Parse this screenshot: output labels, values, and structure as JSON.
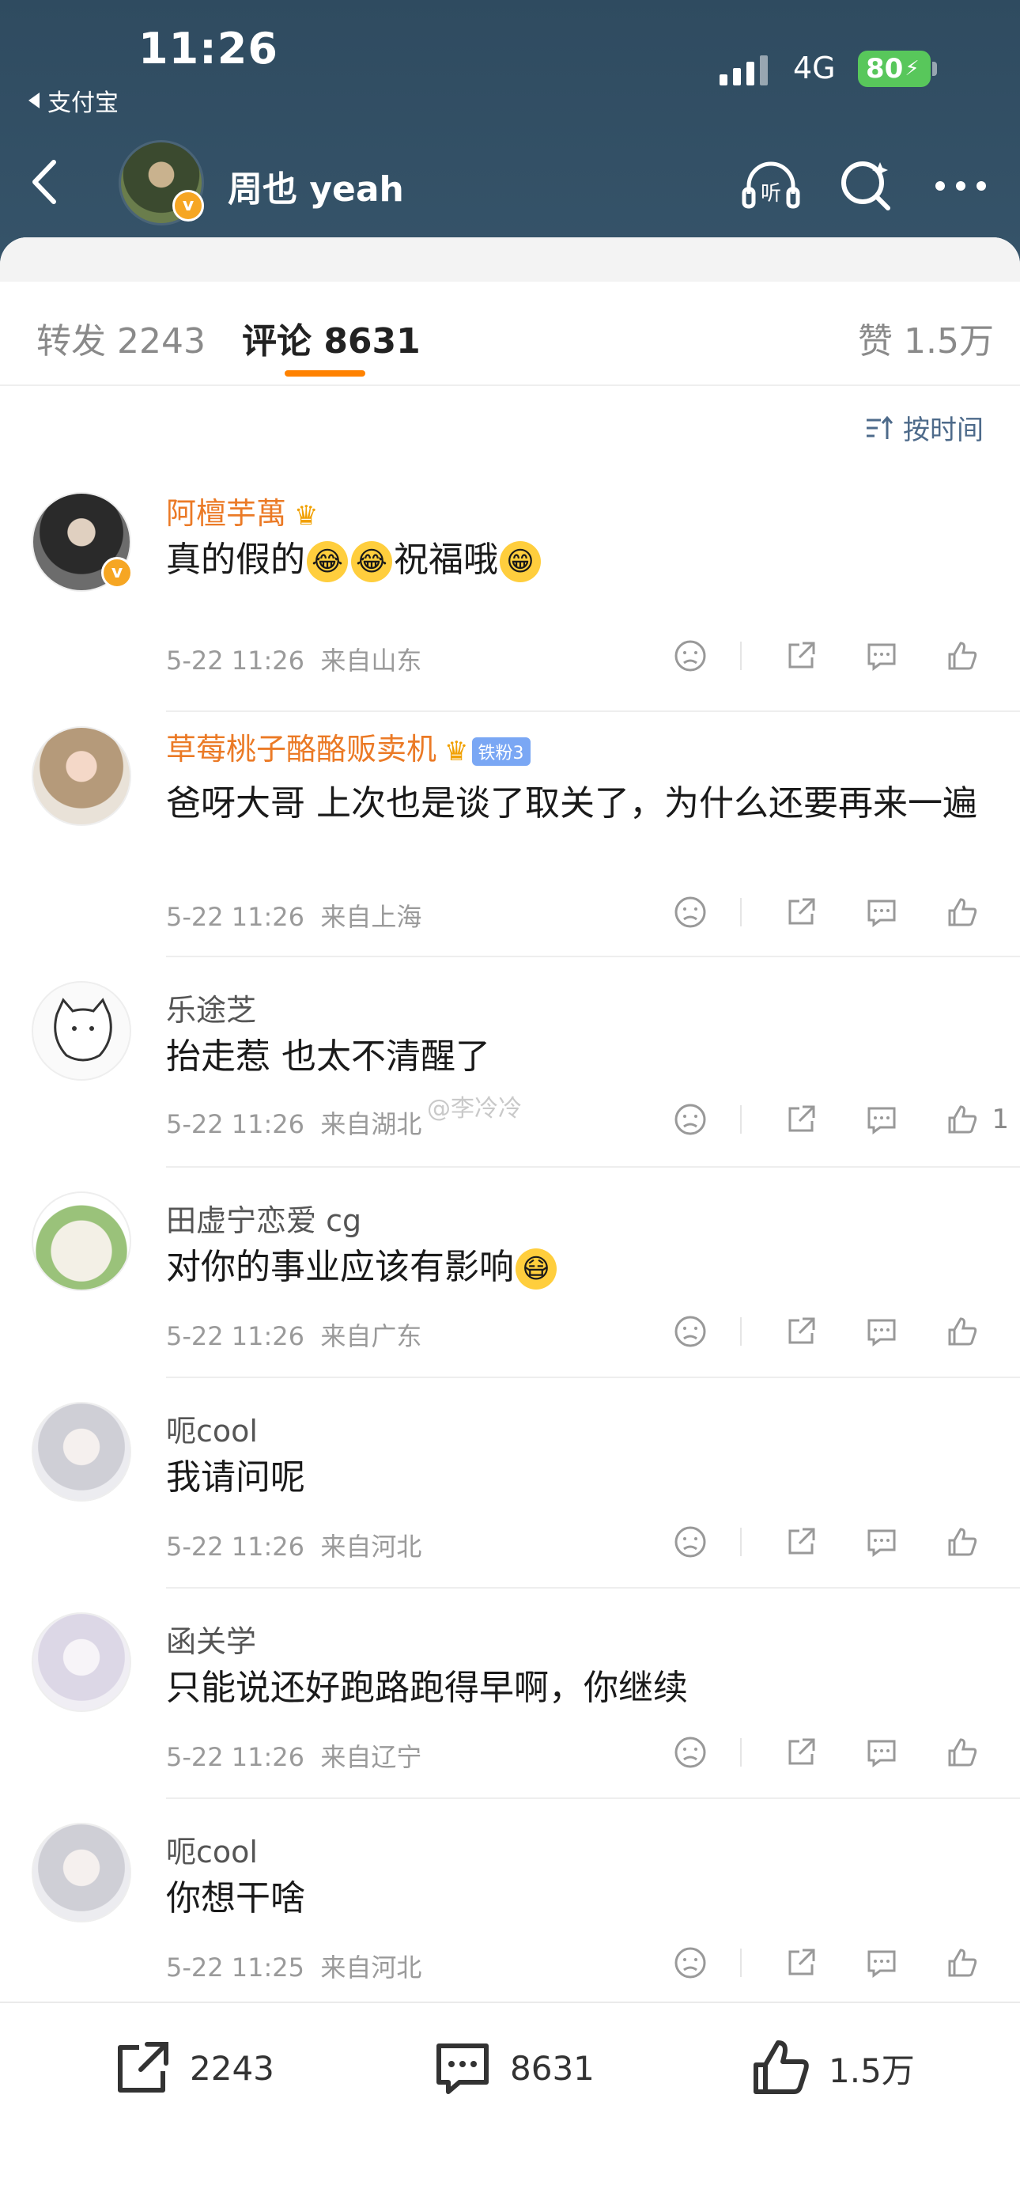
{
  "status_bar": {
    "time": "11:26",
    "back_app": "支付宝",
    "network": "4G",
    "battery": "80"
  },
  "header": {
    "user_name": "周也 yeah",
    "verified_badge": "v",
    "icons": [
      "back-icon",
      "listen-icon",
      "search-icon",
      "more-icon"
    ],
    "listen_label": "听"
  },
  "tabs": [
    {
      "label": "转发 2243"
    },
    {
      "label": "评论 8631"
    },
    {
      "label": "赞 1.5万"
    }
  ],
  "sort": {
    "label": "按时间"
  },
  "comments": [
    {
      "name": "阿檀芋萬",
      "text_parts": [
        "真的假的",
        "😂",
        "😂",
        "祝福哦",
        "😁"
      ],
      "time": "5-22 11:26",
      "location": "来自山东",
      "likes": ""
    },
    {
      "name": "草莓桃子酪酪贩卖机",
      "fan_badge": "铁粉3",
      "text": "爸呀大哥 上次也是谈了取关了，为什么还要再来一遍",
      "time": "5-22 11:26",
      "location": "来自上海",
      "likes": ""
    },
    {
      "name": "乐途芝",
      "text": "抬走惹 也太不清醒了",
      "time": "5-22 11:26",
      "location": "来自湖北",
      "likes": "1"
    },
    {
      "name": "田虚宁恋爱 cg",
      "text": "对你的事业应该有影响",
      "emoji": "😷",
      "time": "5-22 11:26",
      "location": "来自广东",
      "likes": ""
    },
    {
      "name": "呃cool",
      "text": "我请问呢",
      "time": "5-22 11:26",
      "location": "来自河北",
      "likes": ""
    },
    {
      "name": "函关学",
      "text": "只能说还好跑路跑得早啊，你继续",
      "time": "5-22 11:26",
      "location": "来自辽宁",
      "likes": ""
    },
    {
      "name": "呃cool",
      "text": "你想干啥",
      "time": "5-22 11:25",
      "location": "来自河北",
      "likes": ""
    }
  ],
  "watermark": "@李冷冷",
  "bottom_bar": {
    "repost": "2243",
    "comment": "8631",
    "like": "1.5万"
  },
  "colors": {
    "header_bg": "#2f4b60",
    "accent": "#ff8200",
    "vip_name": "#eb7a26",
    "link": "#4d6a8a"
  }
}
